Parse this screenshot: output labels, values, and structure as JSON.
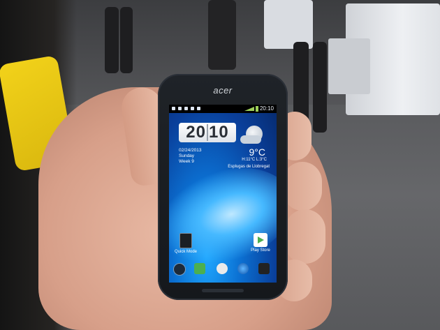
{
  "phone": {
    "brand": "acer",
    "status_time": "20:10"
  },
  "widget": {
    "clock_hour": "20",
    "clock_minute": "10",
    "date": "02/24/2013",
    "day": "Sunday",
    "week": "Week 9",
    "temperature": "9°C",
    "hilo": "H:11°C L:3°C",
    "city": "Esplugas de Llobregat"
  },
  "shortcuts": {
    "quick_mode": "Quick Mode",
    "play_store": "Play Store"
  },
  "dock": [
    "phone-icon",
    "messaging-icon",
    "app-drawer-icon",
    "browser-icon",
    "camera-icon"
  ]
}
